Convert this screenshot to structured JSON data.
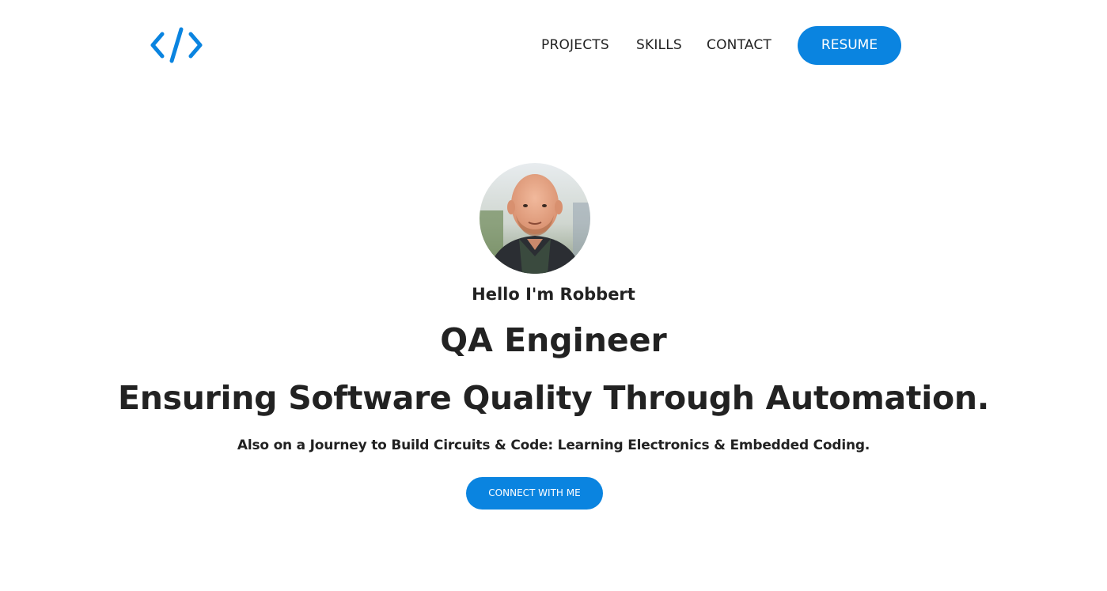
{
  "header": {
    "logo_icon": "code-brackets-icon",
    "nav": {
      "projects": "PROJECTS",
      "skills": "SKILLS",
      "contact": "CONTACT"
    },
    "resume_label": "RESUME"
  },
  "hero": {
    "avatar_icon": "profile-photo",
    "greeting": "Hello I'm Robbert",
    "role": "QA Engineer",
    "headline": "Ensuring Software Quality Through Automation.",
    "subline": "Also on a Journey to Build Circuits & Code: Learning Electronics & Embedded Coding.",
    "cta_label": "CONNECT WITH ME"
  },
  "colors": {
    "accent": "#0a84e0",
    "text": "#222222",
    "background": "#ffffff"
  }
}
